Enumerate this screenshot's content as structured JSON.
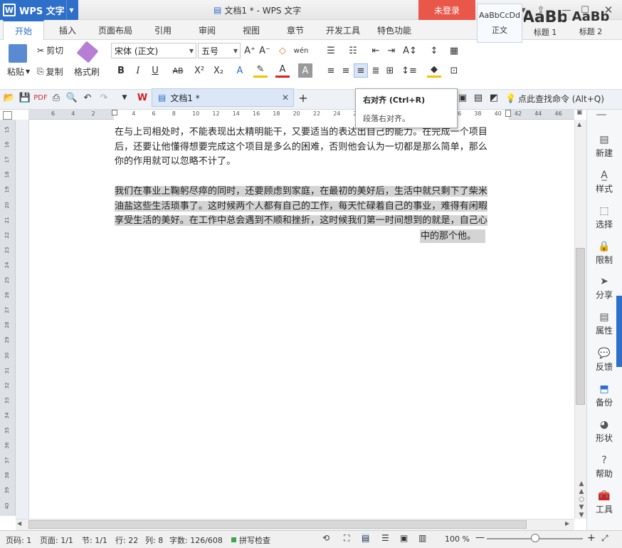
{
  "titlebar": {
    "app_name": "WPS 文字",
    "doc_title": "文档1 * - WPS 文字",
    "login_label": "未登录"
  },
  "tabs": [
    {
      "label": "开始",
      "active": true
    },
    {
      "label": "插入"
    },
    {
      "label": "页面布局"
    },
    {
      "label": "引用"
    },
    {
      "label": "审阅"
    },
    {
      "label": "视图"
    },
    {
      "label": "章节"
    },
    {
      "label": "开发工具"
    },
    {
      "label": "特色功能"
    }
  ],
  "ribbon": {
    "paste": "粘贴",
    "cut": "剪切",
    "copy": "复制",
    "format_painter": "格式刷",
    "font_name": "宋体 (正文)",
    "font_size": "五号",
    "styles": [
      {
        "preview": "AaBbCcDd",
        "label": "正文"
      },
      {
        "preview": "AaBb",
        "label": "标题 1"
      },
      {
        "preview": "AaBb",
        "label": "标题 2"
      }
    ]
  },
  "quickbar": {
    "doc_tab": "文档1 *",
    "search_hint": "点此查找命令 (Alt+Q)"
  },
  "ruler": {
    "h_ticks": [
      "6",
      "4",
      "2",
      "2",
      "4",
      "6",
      "8",
      "10",
      "12",
      "14",
      "16",
      "18",
      "20",
      "22",
      "24",
      "26",
      "28",
      "30",
      "32",
      "34",
      "36",
      "38",
      "40",
      "42",
      "44",
      "46"
    ],
    "v_ticks": [
      "15",
      "16",
      "17",
      "18",
      "19",
      "20",
      "21",
      "22",
      "23",
      "24",
      "25",
      "26",
      "27",
      "28",
      "29",
      "30",
      "31",
      "32",
      "33",
      "34",
      "35",
      "36",
      "37",
      "38",
      "39",
      "40"
    ]
  },
  "document": {
    "para1_lines": [
      "在与上司相处时，不能表现出太精明能干，又要适当的表达出自己的能力。在完成一个项目",
      "后，还要让他懂得想要完成这个项目是多么的困难，否则他会认为一切都是那么简单，那么",
      "你的作用就可以忽略不计了。"
    ],
    "para2_lines": [
      "我们在事业上鞠躬尽瘁的同时，还要顾虑到家庭，在最初的美好后，生活中就只剩下了柴米",
      "油盐这些生活琐事了。这时候两个人都有自己的工作，每天忙碌着自己的事业，难得有闲暇",
      "享受生活的美好。在工作中总会遇到不顺和挫折，这时候我们第一时间想到的就是，自己心"
    ],
    "para2_last": "中的那个他。"
  },
  "tooltip": {
    "title": "右对齐 (Ctrl+R)",
    "desc": "段落右对齐。"
  },
  "sidepanel": [
    {
      "label": "新建",
      "icon": "new-doc-icon"
    },
    {
      "label": "样式",
      "icon": "style-icon"
    },
    {
      "label": "选择",
      "icon": "select-icon"
    },
    {
      "label": "限制",
      "icon": "restrict-icon"
    },
    {
      "label": "分享",
      "icon": "share-icon"
    },
    {
      "label": "属性",
      "icon": "property-icon"
    },
    {
      "label": "反馈",
      "icon": "feedback-icon"
    },
    {
      "label": "备份",
      "icon": "backup-icon"
    },
    {
      "label": "形状",
      "icon": "shape-icon"
    },
    {
      "label": "帮助",
      "icon": "help-icon"
    },
    {
      "label": "工具",
      "icon": "tools-icon"
    }
  ],
  "status": {
    "page_code": "页码: 1",
    "page": "页面: 1/1",
    "section": "节: 1/1",
    "row": "行: 22",
    "col": "列: 8",
    "word_count": "字数: 126/608",
    "spell_check": "拼写检查",
    "zoom": "100 %"
  },
  "colors": {
    "accent": "#2d6fc9",
    "login": "#e8574a",
    "selection": "#d4d4d4"
  }
}
